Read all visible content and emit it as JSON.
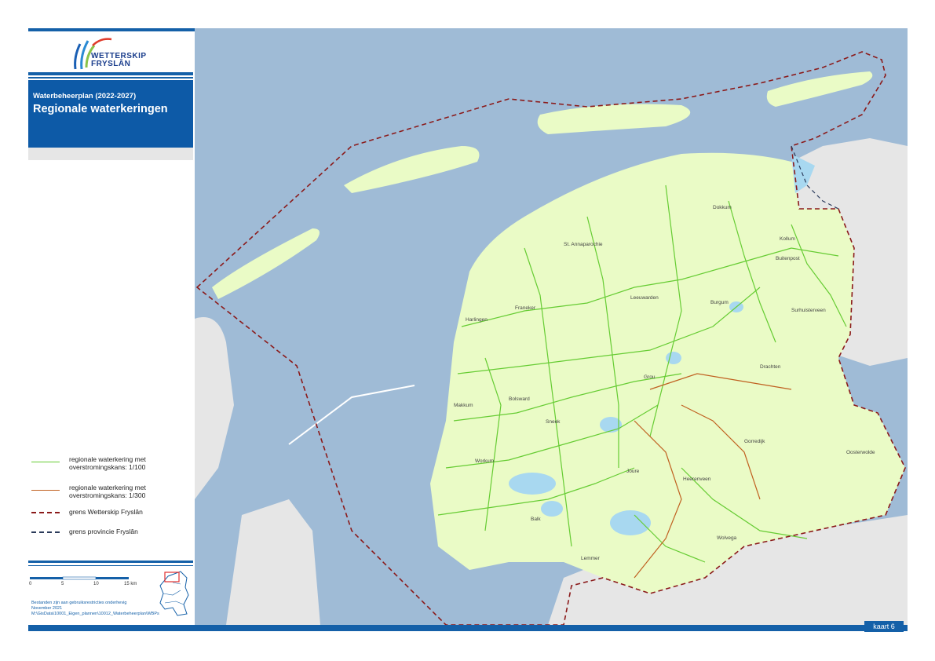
{
  "logo": {
    "line1": "WETTERSKIP",
    "line2": "FRYSLÂN"
  },
  "header": {
    "subtitle": "Waterbeheerplan (2022-2027)",
    "title": "Regionale waterkeringen"
  },
  "legend": [
    {
      "line1": "regionale waterkering met",
      "line2": "overstromingskans: 1/100",
      "color": "#66cc33",
      "style": "solid"
    },
    {
      "line1": "regionale waterkering met",
      "line2": "overstromingskans: 1/300",
      "color": "#c06020",
      "style": "solid"
    },
    {
      "line1": "grens Wetterskip Fryslân",
      "line2": "",
      "color": "#8b1a1a",
      "style": "dashed"
    },
    {
      "line1": "grens provincie Fryslân",
      "line2": "",
      "color": "#2a3a5a",
      "style": "dashed"
    }
  ],
  "scalebar": {
    "labels": [
      "0",
      "5",
      "10",
      "15 km"
    ]
  },
  "notes": [
    "Bestanden zijn aan gebruiksrestricties onderhevig",
    "November 2021",
    "M:\\GisData\\10001_Eigen_plannen\\10012_Waterbeheerplan\\WBPs"
  ],
  "map_labels": [
    "Dokkum",
    "Kollum",
    "Buitenpost",
    "St. Annaparochie",
    "Leeuwarden",
    "Franeker",
    "Harlingen",
    "Burgum",
    "Surhuisterveen",
    "Drachten",
    "Grou",
    "Bolsward",
    "Makkum",
    "Sneek",
    "Gorredijk",
    "Oosterwolde",
    "Joure",
    "Heerenveen",
    "Workum",
    "Balk",
    "Wolvega",
    "Lemmer"
  ],
  "footer": {
    "kaart": "kaart 6"
  },
  "colors": {
    "sea": "#9fbbd6",
    "land_frisian": "#eafbc6",
    "land_other": "#e6e6e6",
    "lake": "#a8d8f0",
    "brand_blue": "#0d5aa7"
  }
}
